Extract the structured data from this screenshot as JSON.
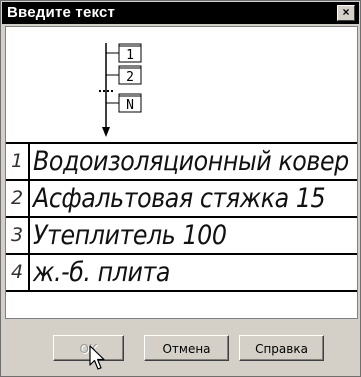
{
  "window": {
    "title": "Введите текст",
    "close_glyph": "×"
  },
  "diagram": {
    "labels": [
      "1",
      "2",
      "N"
    ]
  },
  "rows": [
    {
      "num": "1",
      "text": "Водоизоляционный ковер"
    },
    {
      "num": "2",
      "text": "Асфальтовая стяжка 15"
    },
    {
      "num": "3",
      "text": "Утеплитель 100"
    },
    {
      "num": "4",
      "text": "ж.-б. плита"
    }
  ],
  "buttons": {
    "ok": "ОК",
    "cancel": "Отмена",
    "help": "Справка"
  },
  "icons": {
    "close": "close-icon",
    "cursor": "mouse-pointer-icon"
  }
}
